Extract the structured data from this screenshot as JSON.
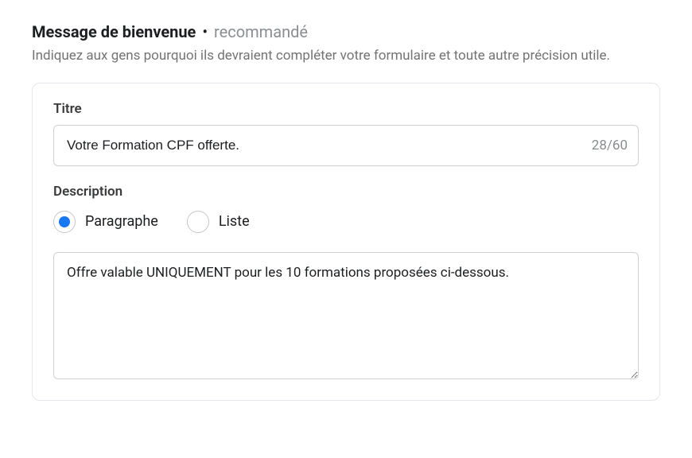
{
  "header": {
    "title": "Message de bienvenue",
    "bullet": "•",
    "tag": "recommandé",
    "subtitle": "Indiquez aux gens pourquoi ils devraient compléter votre formulaire et toute autre précision utile."
  },
  "title_field": {
    "label": "Titre",
    "value": "Votre Formation CPF offerte.",
    "counter": "28/60"
  },
  "description_field": {
    "label": "Description",
    "options": {
      "paragraph": "Paragraphe",
      "list": "Liste"
    },
    "selected": "paragraph",
    "value": "Offre valable UNIQUEMENT pour les 10 formations proposées ci-dessous."
  }
}
